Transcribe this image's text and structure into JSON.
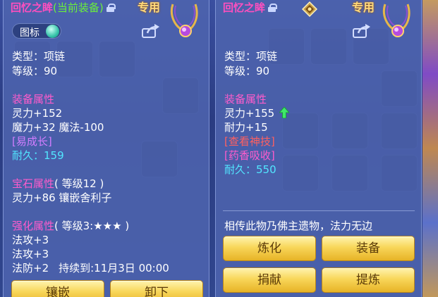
{
  "left_panel": {
    "item_name": "回忆之眸",
    "equipped_tag": "(当前装备)",
    "exclusive_label": "专用",
    "icon_toggle_label": "图标",
    "type_line": "类型：项链",
    "level_line": "等级：90",
    "attr_header": "装备属性",
    "attr_lines": [
      "灵力+152",
      "魔力+32 魔法-100"
    ],
    "special_skill": "[易成长]",
    "durability": "耐久：159",
    "gem_header": "宝石属性",
    "gem_level": "( 等级12 )",
    "gem_line": "灵力+86 镶嵌舍利子",
    "enhance_header": "强化属性",
    "enhance_level": "( 等级3:★★★ )",
    "enhance_lines": [
      "法攻+3",
      "法攻+3"
    ],
    "enhance_last": "法防+2",
    "duration": "持续到:11月3日 00:00",
    "buttons": [
      "镶嵌",
      "卸下"
    ]
  },
  "right_panel": {
    "item_name": "回忆之眸",
    "exclusive_label": "专用",
    "type_line": "类型：项链",
    "level_line": "等级：90",
    "attr_header": "装备属性",
    "attr_lines": [
      "灵力+155",
      "耐力+15"
    ],
    "special_skill": "[查看神技]",
    "special_effect": "[药香吸收]",
    "durability": "耐久：550",
    "description": "相传此物乃佛主遗物，法力无边",
    "buttons": [
      "炼化",
      "装备",
      "捐献",
      "提炼"
    ]
  },
  "colors": {
    "name_pink": "#ff4fbf",
    "equipped_green": "#6af03a",
    "header_pink": "#ff5ccc",
    "cyan": "#52e6ff",
    "red": "#ff6060",
    "button_gold": "#f8d65a"
  },
  "icons": [
    "lock-icon",
    "share-icon",
    "necklace-icon",
    "badge-icon",
    "up-arrow-icon"
  ]
}
